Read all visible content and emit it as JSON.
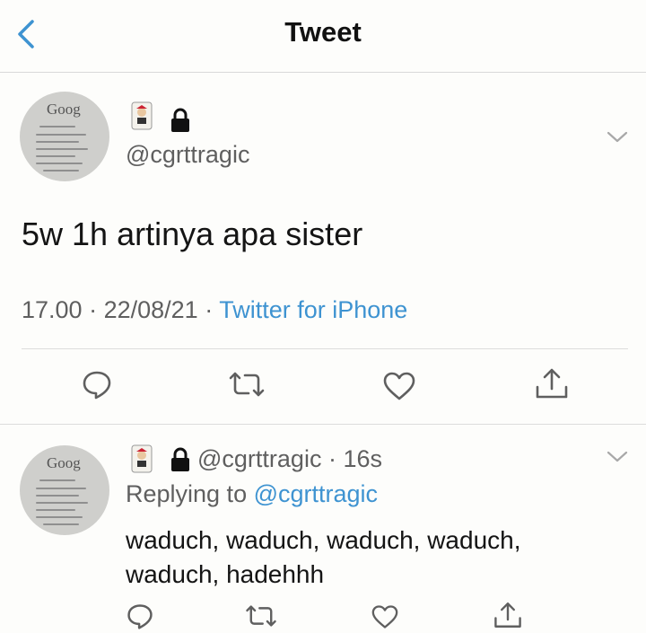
{
  "header": {
    "title": "Tweet",
    "back_icon": "chevron-left-icon",
    "accent_color": "#3e93d1"
  },
  "tweet": {
    "avatar_text": "Goog",
    "handle": "@cgrttragic",
    "text": "5w 1h artinya apa sister",
    "time": "17.00",
    "date": "22/08/21",
    "source": "Twitter for iPhone"
  },
  "reply": {
    "avatar_text": "Goog",
    "handle": "@cgrttragic",
    "age": "16s",
    "replying_label": "Replying to",
    "replying_to": "@cgrttragic",
    "text": "waduch, waduch, waduch, waduch, waduch, hadehhh"
  },
  "actions": [
    "reply-icon",
    "retweet-icon",
    "like-icon",
    "share-icon"
  ]
}
